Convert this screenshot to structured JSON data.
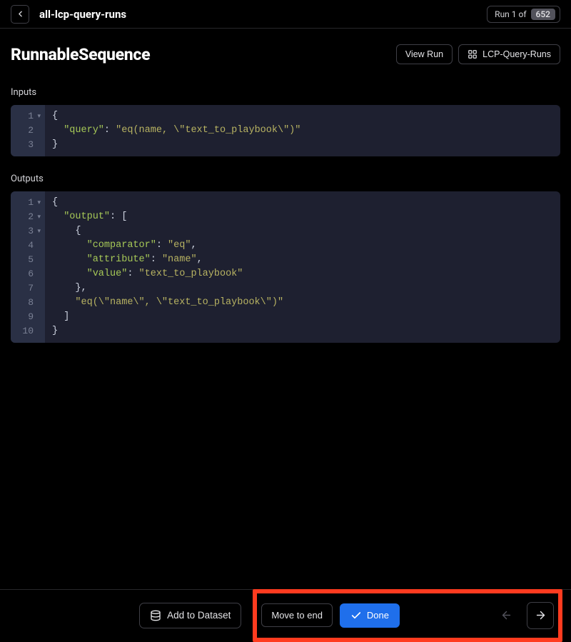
{
  "breadcrumb": "all-lcp-query-runs",
  "run_badge": {
    "prefix": "Run 1 of",
    "total": "652"
  },
  "page_title": "RunnableSequence",
  "header_actions": {
    "view_run": "View Run",
    "dataset_link": "LCP-Query-Runs"
  },
  "sections": {
    "inputs": "Inputs",
    "outputs": "Outputs"
  },
  "inputs_code": {
    "lines": [
      "1",
      "2",
      "3"
    ],
    "json": {
      "query": "eq(name, \\\"text_to_playbook\\\")"
    }
  },
  "outputs_code": {
    "lines": [
      "1",
      "2",
      "3",
      "4",
      "5",
      "6",
      "7",
      "8",
      "9",
      "10"
    ],
    "json": {
      "output": [
        {
          "comparator": "eq",
          "attribute": "name",
          "value": "text_to_playbook"
        },
        "eq(\\\"name\\\", \\\"text_to_playbook\\\")"
      ]
    }
  },
  "footer": {
    "add_to_dataset": "Add to Dataset",
    "move_to_end": "Move to end",
    "done": "Done"
  }
}
